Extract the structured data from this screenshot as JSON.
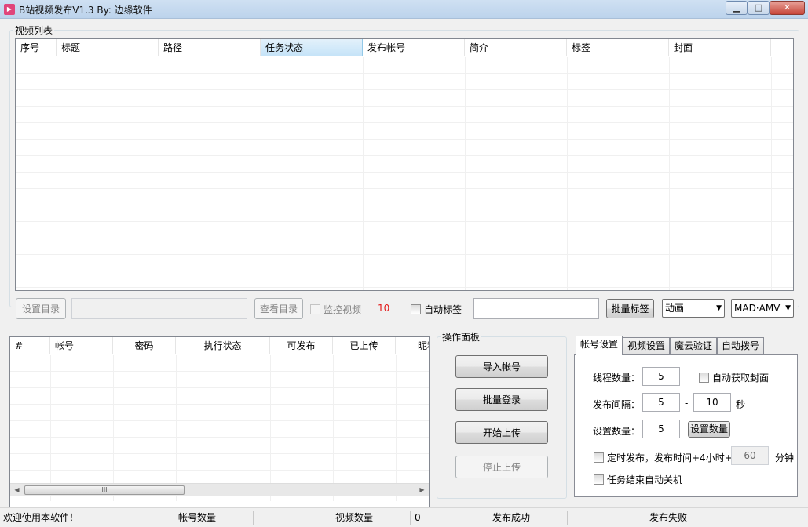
{
  "window": {
    "title": "B站视频发布V1.3  By: 边缘软件",
    "icon": "bilibili-app-icon",
    "controls": {
      "minimize": "▁",
      "maximize": "□",
      "close": "✕"
    }
  },
  "video_list": {
    "legend": "视频列表",
    "columns": [
      "序号",
      "标题",
      "路径",
      "任务状态",
      "发布帐号",
      "简介",
      "标签",
      "封面"
    ],
    "active_column": "任务状态",
    "rows": []
  },
  "toolbar": {
    "set_dir_label": "设置目录",
    "dir_path_value": "",
    "view_dir_label": "查看目录",
    "monitor_video_label": "监控视频",
    "monitor_count": "10",
    "auto_tag_label": "自动标签",
    "tag_input_value": "",
    "batch_tag_label": "批量标签",
    "category_value": "动画",
    "subcategory_value": "MAD·AMV",
    "count_color": "#e31a1a"
  },
  "account_list": {
    "columns": [
      "#",
      "帐号",
      "密码",
      "执行状态",
      "可发布",
      "已上传",
      "昵称"
    ],
    "rows": []
  },
  "ops_panel": {
    "legend": "操作面板",
    "import_accounts_label": "导入帐号",
    "batch_login_label": "批量登录",
    "start_upload_label": "开始上传",
    "stop_upload_label": "停止上传"
  },
  "settings": {
    "tabs": [
      "帐号设置",
      "视频设置",
      "魔云验证",
      "自动拨号"
    ],
    "active_tab": "帐号设置",
    "thread_count_label": "线程数量：",
    "thread_count_value": "5",
    "auto_cover_label": "自动获取封面",
    "interval_label": "发布间隔：",
    "interval_min": "5",
    "interval_sep": "-",
    "interval_max": "10",
    "interval_unit": "秒",
    "set_count_label": "设置数量：",
    "set_count_value": "5",
    "set_count_button": "设置数量",
    "scheduled_label": "定时发布，发布时间+4小时+",
    "scheduled_minutes": "60",
    "scheduled_unit": "分钟",
    "shutdown_label": "任务结束自动关机"
  },
  "statusbar": {
    "welcome": "欢迎使用本软件！",
    "account_count_label": "帐号数量",
    "account_count_value": "",
    "video_count_label": "视频数量",
    "video_count_value": "0",
    "publish_success_label": "发布成功",
    "publish_success_value": "",
    "publish_fail_label": "发布失败"
  }
}
